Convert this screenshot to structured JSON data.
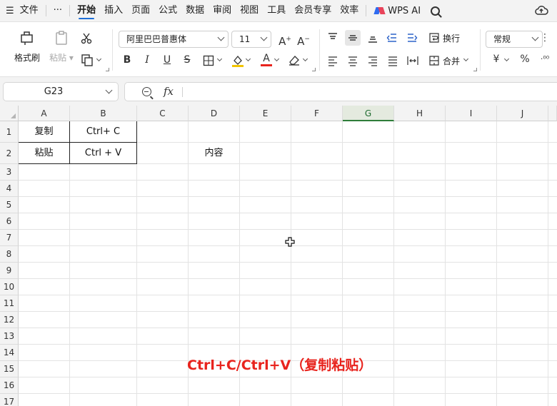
{
  "menu": {
    "items": [
      "文件",
      "开始",
      "插入",
      "页面",
      "公式",
      "数据",
      "审阅",
      "视图",
      "工具",
      "会员专享",
      "效率"
    ],
    "active": "开始",
    "more": "···",
    "wps_ai": "WPS AI"
  },
  "ribbon": {
    "format_painter": "格式刷",
    "paste": "粘贴",
    "font_name": "阿里巴巴普惠体",
    "font_size": "11",
    "wrap_text": "换行",
    "merge": "合并",
    "number_format": "常规",
    "bold": "B",
    "italic": "I",
    "underline": "U",
    "strikethrough": "S",
    "percent": "%",
    "currency": "¥",
    "font_color": "#e8231d"
  },
  "formula_bar": {
    "name_box": "G23",
    "fx_label": "fx",
    "formula": ""
  },
  "sheet": {
    "columns": [
      "A",
      "B",
      "C",
      "D",
      "E",
      "F",
      "G",
      "H",
      "I",
      "J"
    ],
    "selected_column": "G",
    "rows": [
      "1",
      "2",
      "3",
      "4",
      "5",
      "6",
      "7",
      "8",
      "9",
      "10",
      "11",
      "12",
      "13",
      "14",
      "15",
      "16",
      "17"
    ],
    "cells": {
      "A1": "复制",
      "B1": "Ctrl+ C",
      "A2": "粘贴",
      "B2": "Ctrl + V",
      "D2": "内容"
    },
    "caption": "Ctrl+C/Ctrl+V（复制粘贴）",
    "caption_color": "#e8231d"
  }
}
